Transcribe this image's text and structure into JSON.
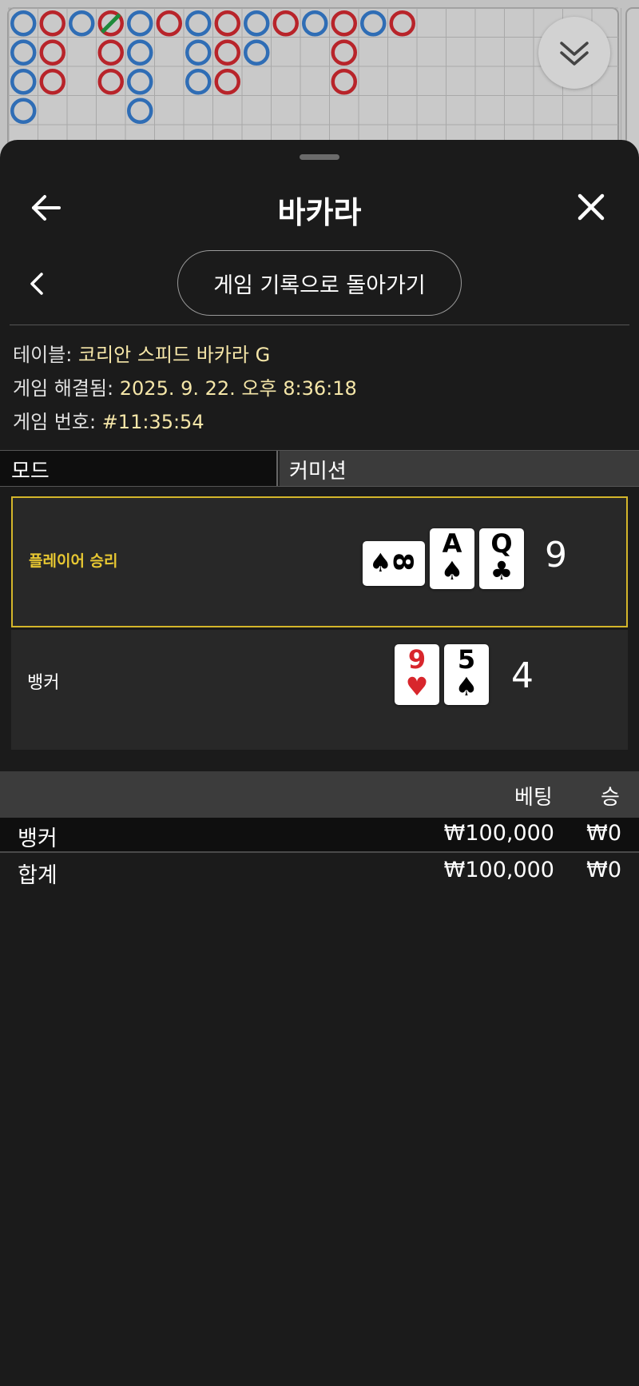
{
  "roadmap": {
    "collapse_icon": "double-chevron-down-icon",
    "colors": {
      "player": "#2f6db5",
      "banker": "#b8242a",
      "tie": "#1e8a3a"
    },
    "columns": [
      [
        "P",
        "P",
        "P",
        "P"
      ],
      [
        "B",
        "B",
        "B"
      ],
      [
        "P"
      ],
      [
        "B",
        "B",
        "B"
      ],
      [
        "P",
        "P",
        "P",
        "P"
      ],
      [
        "B"
      ],
      [
        "P",
        "P",
        "P"
      ],
      [
        "B",
        "B",
        "B"
      ],
      [
        "P",
        "P"
      ],
      [
        "B"
      ],
      [
        "P"
      ],
      [
        "B",
        "B",
        "B"
      ],
      [
        "P"
      ],
      [
        "B"
      ]
    ]
  },
  "sheet": {
    "title": "바카라",
    "back_icon": "arrow-left-icon",
    "close_icon": "close-icon",
    "history_button": "게임 기록으로 돌아가기",
    "chevron_icon": "chevron-left-icon"
  },
  "info": {
    "table_key": "테이블:",
    "table_value": "코리안 스피드 바카라 G",
    "resolved_key": "게임 해결됨:",
    "resolved_value": "2025. 9. 22. 오후 8:36:18",
    "number_key": "게임 번호:",
    "number_value": "#11:35:54"
  },
  "mode": {
    "label": "모드",
    "value": "커미션"
  },
  "results": {
    "player": {
      "label": "플레이어 승리",
      "score": "9",
      "cards": [
        {
          "rank": "8",
          "suit": "♠",
          "color": "#000000",
          "rotated": true
        },
        {
          "rank": "A",
          "suit": "♠",
          "color": "#000000",
          "rotated": false
        },
        {
          "rank": "Q",
          "suit": "♣",
          "color": "#000000",
          "rotated": false
        }
      ],
      "highlight_color": "#d4b62a"
    },
    "banker": {
      "label": "뱅커",
      "score": "4",
      "cards": [
        {
          "rank": "9",
          "suit": "♥",
          "color": "#d8262c",
          "rotated": false
        },
        {
          "rank": "5",
          "suit": "♠",
          "color": "#000000",
          "rotated": false
        }
      ]
    }
  },
  "bets": {
    "headers": {
      "bet": "베팅",
      "win": "승"
    },
    "rows": [
      {
        "name": "뱅커",
        "bet": "₩100,000",
        "win": "₩0"
      }
    ],
    "total": {
      "name": "합계",
      "bet": "₩100,000",
      "win": "₩0"
    }
  }
}
